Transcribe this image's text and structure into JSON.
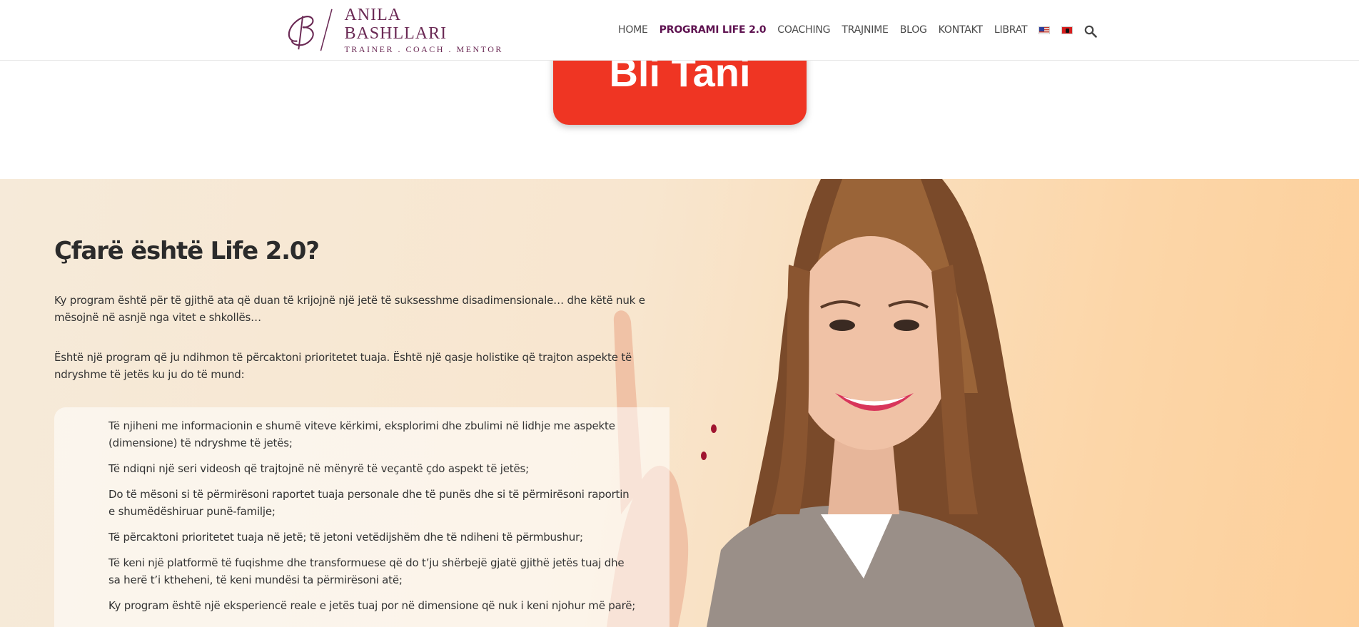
{
  "header": {
    "logo_name": "ANILA BASHLLARI",
    "logo_tagline": "TRAINER . COACH . MENTOR",
    "nav": [
      {
        "label": "HOME",
        "active": false
      },
      {
        "label": "PROGRAMI LIFE 2.0",
        "active": true
      },
      {
        "label": "COACHING",
        "active": false
      },
      {
        "label": "TRAJNIME",
        "active": false
      },
      {
        "label": "BLOG",
        "active": false
      },
      {
        "label": "KONTAKT",
        "active": false
      },
      {
        "label": "LIBRAT",
        "active": false
      }
    ],
    "flags": [
      "us-flag-icon",
      "albania-flag-icon"
    ],
    "search_icon": "search-icon"
  },
  "cta": {
    "label": "Bli Tani",
    "color": "#ef3523"
  },
  "section": {
    "title": "Çfarë është Life 2.0?",
    "paragraph_1": "Ky program është për të gjithë ata që duan të krijojnë një jetë të suksesshme disadimensionale… dhe këtë nuk e mësojnë në asnjë nga vitet e shkollës…",
    "paragraph_2": "Është një program që ju ndihmon të përcaktoni prioritetet tuaja. Është një qasje holistike që trajton aspekte të ndryshme të jetës ku ju do të mund:",
    "list": [
      "Të njiheni me informacionin e shumë viteve kërkimi, eksplorimi dhe zbulimi në lidhje me aspekte (dimensione) të ndryshme të jetës;",
      "Të ndiqni një seri videosh që trajtojnë në mënyrë të veçantë çdo aspekt të jetës;",
      "Do të mësoni si të përmirësoni raportet tuaja personale dhe të punës dhe si të përmirësoni raportin e shumëdëshiruar punë-familje;",
      "Të përcaktoni prioritetet tuaja në jetë; të jetoni vetëdijshëm dhe të ndiheni të përmbushur;",
      "Të keni një platformë të fuqishme dhe transformuese që do t’ju shërbejë gjatë gjithë jetës tuaj dhe sa herë t’i ktheheni,  të keni mundësi ta përmirësoni atë;",
      "Ky program është një eksperiencë reale e jetës tuaj por në dimensione që nuk i keni njohur më parë;"
    ]
  },
  "colors": {
    "brand": "#6b2a55",
    "nav_active": "#5e1250",
    "hero_bg": "#f8e6cf"
  }
}
